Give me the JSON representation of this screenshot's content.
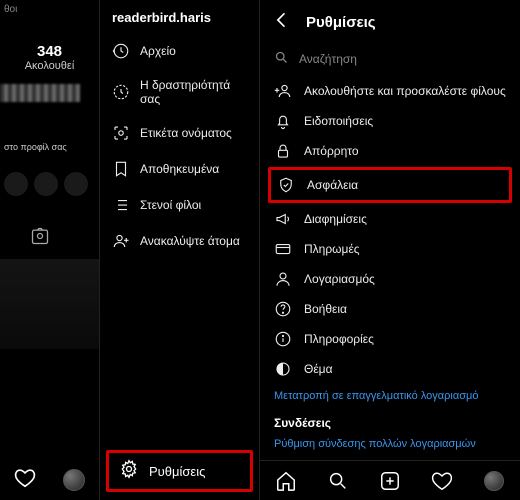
{
  "profile": {
    "followers_count": "348",
    "followers_label": "Ακολουθεί",
    "obscured_label": "θοι",
    "small_text": "στο προφίλ σας"
  },
  "col2": {
    "username": "readerbird.haris",
    "items": [
      {
        "label": "Αρχείο"
      },
      {
        "label": "Η δραστηριότητά σας"
      },
      {
        "label": "Ετικέτα ονόματος"
      },
      {
        "label": "Αποθηκευμένα"
      },
      {
        "label": "Στενοί φίλοι"
      },
      {
        "label": "Ανακαλύψτε άτομα"
      }
    ],
    "settings_label": "Ρυθμίσεις"
  },
  "col3": {
    "title": "Ρυθμίσεις",
    "search_placeholder": "Αναζήτηση",
    "items": [
      {
        "label": "Ακολουθήστε και προσκαλέστε φίλους"
      },
      {
        "label": "Ειδοποιήσεις"
      },
      {
        "label": "Απόρρητο"
      },
      {
        "label": "Ασφάλεια"
      },
      {
        "label": "Διαφημίσεις"
      },
      {
        "label": "Πληρωμές"
      },
      {
        "label": "Λογαριασμός"
      },
      {
        "label": "Βοήθεια"
      },
      {
        "label": "Πληροφορίες"
      },
      {
        "label": "Θέμα"
      }
    ],
    "professional_link": "Μετατροπή σε επαγγελματικό λογαριασμό",
    "connections_label": "Συνδέσεις",
    "multi_account_link": "Ρύθμιση σύνδεσης πολλών λογαριασμών"
  }
}
